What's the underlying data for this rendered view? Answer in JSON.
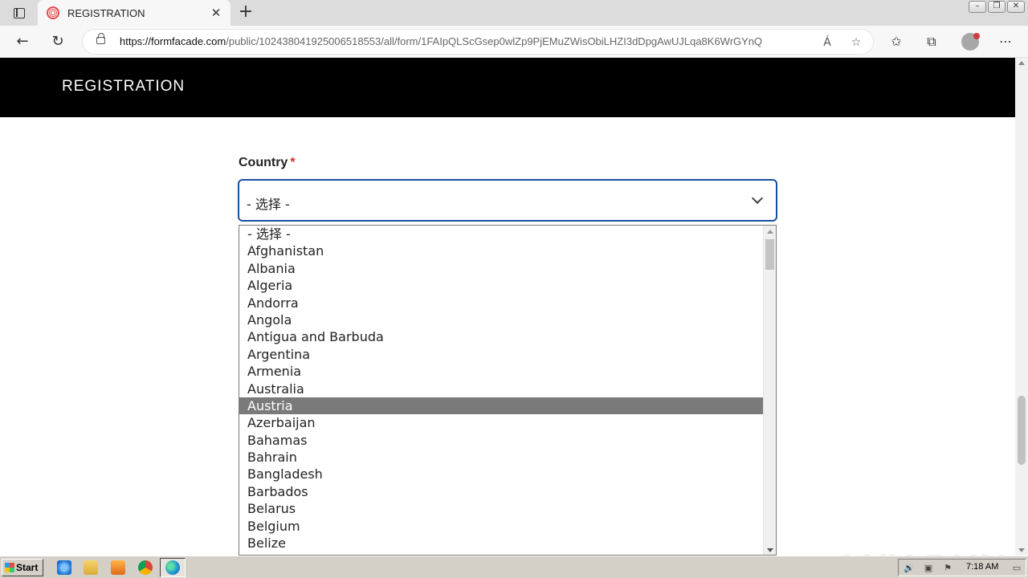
{
  "browser": {
    "tab_title": "REGISTRATION",
    "tab_close": "✕",
    "new_tab": "+",
    "url_host": "https://formfacade.com",
    "url_path": "/public/102438041925006518553/all/form/1FAIpQLScGsep0wlZp9PjEMuZWisObiLHZI3dDpgAwUJLqa8K6WrGYnQ",
    "read_aloud": "Á",
    "back": "←",
    "refresh": "↻"
  },
  "page": {
    "header_title": "REGISTRATION",
    "field_label": "Country",
    "required_mark": "*",
    "select_value": "- 选择 -",
    "options": [
      "- 选择 -",
      "Afghanistan",
      "Albania",
      "Algeria",
      "Andorra",
      "Angola",
      "Antigua and Barbuda",
      "Argentina",
      "Armenia",
      "Australia",
      "Austria",
      "Azerbaijan",
      "Bahamas",
      "Bahrain",
      "Bangladesh",
      "Barbados",
      "Belarus",
      "Belgium",
      "Belize"
    ],
    "highlighted_option": "Austria",
    "watermark": "ANY RUN"
  },
  "taskbar": {
    "start_label": "Start",
    "clock": "7:18 AM"
  },
  "colors": {
    "accent": "#1a4fa0",
    "header_bg": "#000000",
    "highlight_bg": "#7a7a7a",
    "required": "#d93025"
  }
}
